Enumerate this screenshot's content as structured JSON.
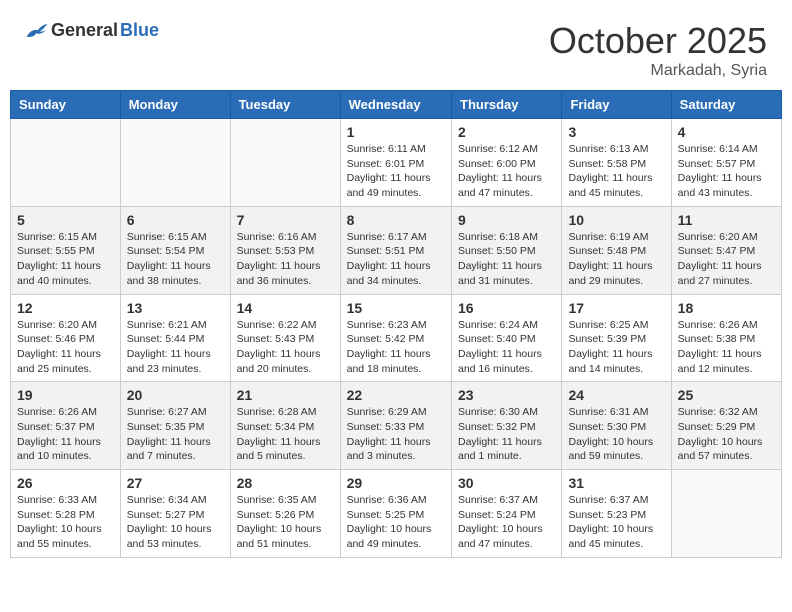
{
  "header": {
    "logo_general": "General",
    "logo_blue": "Blue",
    "month": "October 2025",
    "location": "Markadah, Syria"
  },
  "days_of_week": [
    "Sunday",
    "Monday",
    "Tuesday",
    "Wednesday",
    "Thursday",
    "Friday",
    "Saturday"
  ],
  "weeks": [
    [
      {
        "day": "",
        "info": ""
      },
      {
        "day": "",
        "info": ""
      },
      {
        "day": "",
        "info": ""
      },
      {
        "day": "1",
        "info": "Sunrise: 6:11 AM\nSunset: 6:01 PM\nDaylight: 11 hours\nand 49 minutes."
      },
      {
        "day": "2",
        "info": "Sunrise: 6:12 AM\nSunset: 6:00 PM\nDaylight: 11 hours\nand 47 minutes."
      },
      {
        "day": "3",
        "info": "Sunrise: 6:13 AM\nSunset: 5:58 PM\nDaylight: 11 hours\nand 45 minutes."
      },
      {
        "day": "4",
        "info": "Sunrise: 6:14 AM\nSunset: 5:57 PM\nDaylight: 11 hours\nand 43 minutes."
      }
    ],
    [
      {
        "day": "5",
        "info": "Sunrise: 6:15 AM\nSunset: 5:55 PM\nDaylight: 11 hours\nand 40 minutes."
      },
      {
        "day": "6",
        "info": "Sunrise: 6:15 AM\nSunset: 5:54 PM\nDaylight: 11 hours\nand 38 minutes."
      },
      {
        "day": "7",
        "info": "Sunrise: 6:16 AM\nSunset: 5:53 PM\nDaylight: 11 hours\nand 36 minutes."
      },
      {
        "day": "8",
        "info": "Sunrise: 6:17 AM\nSunset: 5:51 PM\nDaylight: 11 hours\nand 34 minutes."
      },
      {
        "day": "9",
        "info": "Sunrise: 6:18 AM\nSunset: 5:50 PM\nDaylight: 11 hours\nand 31 minutes."
      },
      {
        "day": "10",
        "info": "Sunrise: 6:19 AM\nSunset: 5:48 PM\nDaylight: 11 hours\nand 29 minutes."
      },
      {
        "day": "11",
        "info": "Sunrise: 6:20 AM\nSunset: 5:47 PM\nDaylight: 11 hours\nand 27 minutes."
      }
    ],
    [
      {
        "day": "12",
        "info": "Sunrise: 6:20 AM\nSunset: 5:46 PM\nDaylight: 11 hours\nand 25 minutes."
      },
      {
        "day": "13",
        "info": "Sunrise: 6:21 AM\nSunset: 5:44 PM\nDaylight: 11 hours\nand 23 minutes."
      },
      {
        "day": "14",
        "info": "Sunrise: 6:22 AM\nSunset: 5:43 PM\nDaylight: 11 hours\nand 20 minutes."
      },
      {
        "day": "15",
        "info": "Sunrise: 6:23 AM\nSunset: 5:42 PM\nDaylight: 11 hours\nand 18 minutes."
      },
      {
        "day": "16",
        "info": "Sunrise: 6:24 AM\nSunset: 5:40 PM\nDaylight: 11 hours\nand 16 minutes."
      },
      {
        "day": "17",
        "info": "Sunrise: 6:25 AM\nSunset: 5:39 PM\nDaylight: 11 hours\nand 14 minutes."
      },
      {
        "day": "18",
        "info": "Sunrise: 6:26 AM\nSunset: 5:38 PM\nDaylight: 11 hours\nand 12 minutes."
      }
    ],
    [
      {
        "day": "19",
        "info": "Sunrise: 6:26 AM\nSunset: 5:37 PM\nDaylight: 11 hours\nand 10 minutes."
      },
      {
        "day": "20",
        "info": "Sunrise: 6:27 AM\nSunset: 5:35 PM\nDaylight: 11 hours\nand 7 minutes."
      },
      {
        "day": "21",
        "info": "Sunrise: 6:28 AM\nSunset: 5:34 PM\nDaylight: 11 hours\nand 5 minutes."
      },
      {
        "day": "22",
        "info": "Sunrise: 6:29 AM\nSunset: 5:33 PM\nDaylight: 11 hours\nand 3 minutes."
      },
      {
        "day": "23",
        "info": "Sunrise: 6:30 AM\nSunset: 5:32 PM\nDaylight: 11 hours\nand 1 minute."
      },
      {
        "day": "24",
        "info": "Sunrise: 6:31 AM\nSunset: 5:30 PM\nDaylight: 10 hours\nand 59 minutes."
      },
      {
        "day": "25",
        "info": "Sunrise: 6:32 AM\nSunset: 5:29 PM\nDaylight: 10 hours\nand 57 minutes."
      }
    ],
    [
      {
        "day": "26",
        "info": "Sunrise: 6:33 AM\nSunset: 5:28 PM\nDaylight: 10 hours\nand 55 minutes."
      },
      {
        "day": "27",
        "info": "Sunrise: 6:34 AM\nSunset: 5:27 PM\nDaylight: 10 hours\nand 53 minutes."
      },
      {
        "day": "28",
        "info": "Sunrise: 6:35 AM\nSunset: 5:26 PM\nDaylight: 10 hours\nand 51 minutes."
      },
      {
        "day": "29",
        "info": "Sunrise: 6:36 AM\nSunset: 5:25 PM\nDaylight: 10 hours\nand 49 minutes."
      },
      {
        "day": "30",
        "info": "Sunrise: 6:37 AM\nSunset: 5:24 PM\nDaylight: 10 hours\nand 47 minutes."
      },
      {
        "day": "31",
        "info": "Sunrise: 6:37 AM\nSunset: 5:23 PM\nDaylight: 10 hours\nand 45 minutes."
      },
      {
        "day": "",
        "info": ""
      }
    ]
  ]
}
